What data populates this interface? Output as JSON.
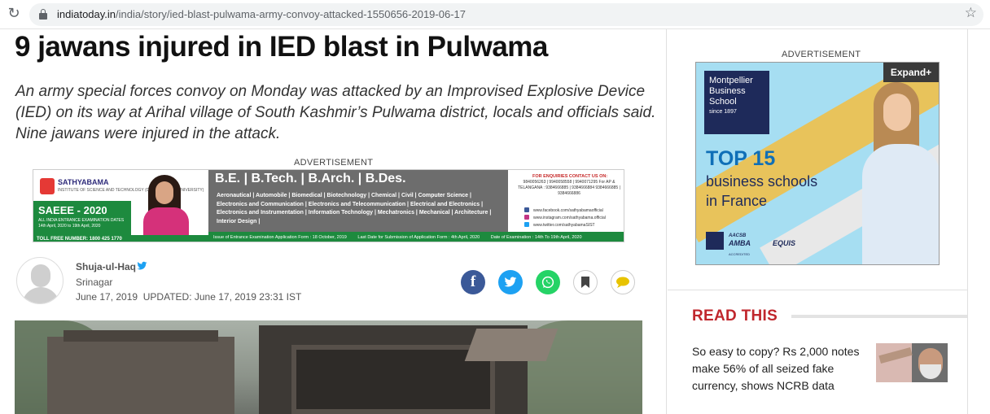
{
  "browser": {
    "url_host": "indiatoday.in",
    "url_path": "/india/story/ied-blast-pulwama-army-convoy-attacked-1550656-2019-06-17"
  },
  "article": {
    "headline": "9 jawans injured in IED blast in Pulwama",
    "summary": "An army special forces convoy on Monday was attacked by an Improvised Explosive Device (IED) on its way at Arihal village of South Kashmir’s Pulwama district, locals and officials said. Nine jawans were injured in the attack.",
    "author": {
      "name": "Shuja-ul-Haq",
      "location": "Srinagar",
      "date": "June 17, 2019",
      "updated": "UPDATED: June 17, 2019 23:31 IST"
    }
  },
  "ads": {
    "label": "ADVERTISEMENT",
    "banner": {
      "brand": "SATHYABAMA",
      "brand_sub": "INSTITUTE OF SCIENCE AND TECHNOLOGY (DEEMED TO BE UNIVERSITY)",
      "exam": "SAEEE - 2020",
      "exam_line1": "ALL INDIA ENTRANCE EXAMINATION DATES",
      "exam_line2": "14th April, 2020 to 19th April, 2020",
      "tollfree": "TOLL FREE NUMBER: 1800 425 1770",
      "degrees": "B.E. | B.Tech. | B.Arch. | B.Des.",
      "courses": "Aeronautical | Automobile | Biomedical | Biotechnology | Chemical | Civil | Computer Science | Electronics and Communication | Electronics and Telecommunication | Electrical and Electronics | Electronics and Instrumentation | Information Technology | Mechatronics | Mechanical | Architecture | Interior Design |",
      "contact_title": "FOR ENQUIRIES CONTACT US ON:",
      "contact_lines": "9840056263 | 9940058558 | 9940071295 For AP & TELANGANA : 9384666885 | 9384666884 9384666885 | 9384666886",
      "facebook": "www.facebook.com/sathyabamaofficial",
      "instagram": "www.instagram.com/sathyabama.official",
      "twitter": "www.twitter.com/sathyabamaSIST",
      "strip1": "Issue of Entrance Examination Application Form : 18 October, 2019",
      "strip2": "Last Date for Submission of Application Form : 4th April, 2020",
      "strip3": "Date of Examination : 14th To 19th April, 2020"
    },
    "side": {
      "school_line1": "Montpellier",
      "school_line2": "Business",
      "school_line3": "School",
      "since": "since 1897",
      "expand": "Expand+",
      "top": "TOP 15",
      "tagline1": "business schools",
      "tagline2": "in France",
      "accred1": "AACSB",
      "accred2": "AMBA",
      "accred3": "EQUIS",
      "accred_small": "ACCREDITED"
    }
  },
  "sidebar": {
    "section_title": "READ THIS",
    "story": "So easy to copy? Rs 2,000 notes make 56% of all seized fake currency, shows NCRB data"
  },
  "colors": {
    "read_this": "#c0272d",
    "facebook": "#3b5998",
    "twitter": "#1da1f2",
    "whatsapp": "#25d366"
  },
  "icons": [
    "reload-icon",
    "lock-icon",
    "star-icon",
    "verified-icon",
    "facebook-icon",
    "twitter-icon",
    "whatsapp-icon",
    "bookmark-icon",
    "comment-icon"
  ]
}
